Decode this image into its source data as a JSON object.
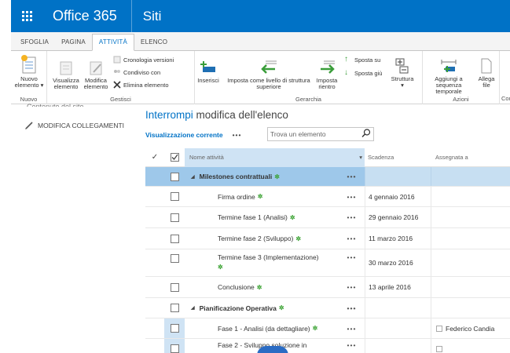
{
  "suite": {
    "brand": "Office 365",
    "site": "Siti"
  },
  "ribbon_tabs": [
    {
      "label": "SFOGLIA"
    },
    {
      "label": "PAGINA"
    },
    {
      "label": "ATTIVITÀ"
    },
    {
      "label": "ELENCO"
    }
  ],
  "ribbon": {
    "nuovo": {
      "label_line1": "Nuovo",
      "label_line2": "elemento ▾",
      "group": "Nuovo"
    },
    "gestisci": {
      "group": "Gestisci",
      "visualizza": {
        "l1": "Visualizza",
        "l2": "elemento"
      },
      "modifica": {
        "l1": "Modifica",
        "l2": "elemento"
      },
      "cronologia": "Cronologia versioni",
      "condiviso": "Condiviso con",
      "elimina": "Elimina elemento"
    },
    "gerarchia": {
      "group": "Gerarchia",
      "inserisci": "Inserisci",
      "imposta_sup": {
        "l1": "Imposta come livello di struttura",
        "l2": "superiore"
      },
      "imposta_rientro": {
        "l1": "Imposta",
        "l2": "rientro"
      },
      "sposta_su": "Sposta su",
      "sposta_giu": "Sposta giù",
      "struttura": {
        "l1": "Struttura",
        "l2": "▾"
      }
    },
    "azioni": {
      "group": "Azioni",
      "sequenza": {
        "l1": "Aggiungi a sequenza",
        "l2": "temporale"
      },
      "allega": {
        "l1": "Allega",
        "l2": "file"
      },
      "cut": "Con"
    }
  },
  "left": {
    "cut_text": "Contenuto del sito",
    "modify_links": "MODIFICA COLLEGAMENTI"
  },
  "main": {
    "title_highlight": "Interrompi",
    "title_rest": " modifica dell'elenco",
    "view_link": "Visualizzazione corrente",
    "view_dots": "•••",
    "search_placeholder": "Trova un elemento"
  },
  "list": {
    "headers": {
      "check": "✓",
      "name": "Nome attività",
      "date": "Scadenza",
      "assigned": "Assegnata a"
    },
    "rows": [
      {
        "name": "Milestones contrattuali",
        "date": "",
        "assigned": "",
        "group": true,
        "new": "✲",
        "dots": "•••"
      },
      {
        "name": "Firma ordine",
        "date": "4 gennaio 2016",
        "assigned": "",
        "new": "✲",
        "dots": "•••"
      },
      {
        "name": "Termine fase 1 (Analisi)",
        "date": "29 gennaio 2016",
        "assigned": "",
        "new": "✲",
        "dots": "•••"
      },
      {
        "name": "Termine fase 2 (Sviluppo)",
        "date": "11 marzo 2016",
        "assigned": "",
        "new": "✲",
        "dots": "•••"
      },
      {
        "name": "Termine fase 3 (Implementazione)",
        "date": "30 marzo 2016",
        "assigned": "",
        "new": "✲",
        "dots": "•••"
      },
      {
        "name": "Conclusione",
        "date": "13 aprile 2016",
        "assigned": "",
        "new": "✲",
        "dots": "•••"
      },
      {
        "name": "Pianificazione Operativa",
        "date": "",
        "assigned": "",
        "group": true,
        "new": "✲",
        "dots": "•••"
      },
      {
        "name": "Fase 1 - Analisi (da dettagliare)",
        "date": "",
        "assigned": "Federico Candia",
        "new": "✲",
        "dots": "•••"
      },
      {
        "name": "Fase 2 - Sviluppo soluzione in",
        "date": "",
        "assigned": "",
        "new": "",
        "dots": "•••"
      }
    ]
  },
  "colors": {
    "suite_blue": "#0072c6",
    "selected_row": "#9ec8ea",
    "new_star": "#36a02e"
  }
}
